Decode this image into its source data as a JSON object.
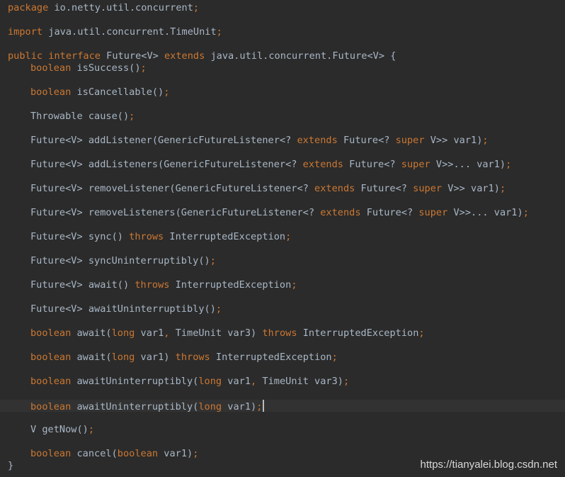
{
  "editor": {
    "theme_colors": {
      "background": "#2b2b2b",
      "keyword": "#cc7832",
      "text": "#a9b7c6",
      "current_line": "#323232"
    },
    "lines": [
      [
        {
          "t": "package",
          "k": "kw"
        },
        {
          "t": " io.netty.util.concurrent",
          "k": "txt"
        },
        {
          "t": ";",
          "k": "sym"
        }
      ],
      [],
      [
        {
          "t": "import",
          "k": "kw"
        },
        {
          "t": " java.util.concurrent.TimeUnit",
          "k": "txt"
        },
        {
          "t": ";",
          "k": "sym"
        }
      ],
      [],
      [
        {
          "t": "public",
          "k": "kw"
        },
        {
          "t": " ",
          "k": "txt"
        },
        {
          "t": "interface",
          "k": "kw"
        },
        {
          "t": " Future<V> ",
          "k": "txt"
        },
        {
          "t": "extends",
          "k": "kw"
        },
        {
          "t": " java.util.concurrent.Future<V> {",
          "k": "txt"
        }
      ],
      [
        {
          "t": "boolean",
          "k": "kw"
        },
        {
          "t": " isSuccess()",
          "k": "txt"
        },
        {
          "t": ";",
          "k": "sym"
        }
      ],
      [],
      [
        {
          "t": "boolean",
          "k": "kw"
        },
        {
          "t": " isCancellable()",
          "k": "txt"
        },
        {
          "t": ";",
          "k": "sym"
        }
      ],
      [],
      [
        {
          "t": "Throwable cause()",
          "k": "txt"
        },
        {
          "t": ";",
          "k": "sym"
        }
      ],
      [],
      [
        {
          "t": "Future<V> addListener(GenericFutureListener<? ",
          "k": "txt"
        },
        {
          "t": "extends",
          "k": "kw"
        },
        {
          "t": " Future<? ",
          "k": "txt"
        },
        {
          "t": "super",
          "k": "kw"
        },
        {
          "t": " V>> var1)",
          "k": "txt"
        },
        {
          "t": ";",
          "k": "sym"
        }
      ],
      [],
      [
        {
          "t": "Future<V> addListeners(GenericFutureListener<? ",
          "k": "txt"
        },
        {
          "t": "extends",
          "k": "kw"
        },
        {
          "t": " Future<? ",
          "k": "txt"
        },
        {
          "t": "super",
          "k": "kw"
        },
        {
          "t": " V>>... var1)",
          "k": "txt"
        },
        {
          "t": ";",
          "k": "sym"
        }
      ],
      [],
      [
        {
          "t": "Future<V> removeListener(GenericFutureListener<? ",
          "k": "txt"
        },
        {
          "t": "extends",
          "k": "kw"
        },
        {
          "t": " Future<? ",
          "k": "txt"
        },
        {
          "t": "super",
          "k": "kw"
        },
        {
          "t": " V>> var1)",
          "k": "txt"
        },
        {
          "t": ";",
          "k": "sym"
        }
      ],
      [],
      [
        {
          "t": "Future<V> removeListeners(GenericFutureListener<? ",
          "k": "txt"
        },
        {
          "t": "extends",
          "k": "kw"
        },
        {
          "t": " Future<? ",
          "k": "txt"
        },
        {
          "t": "super",
          "k": "kw"
        },
        {
          "t": " V>>... var1)",
          "k": "txt"
        },
        {
          "t": ";",
          "k": "sym"
        }
      ],
      [],
      [
        {
          "t": "Future<V> sync() ",
          "k": "txt"
        },
        {
          "t": "throws",
          "k": "kw"
        },
        {
          "t": " InterruptedException",
          "k": "txt"
        },
        {
          "t": ";",
          "k": "sym"
        }
      ],
      [],
      [
        {
          "t": "Future<V> syncUninterruptibly()",
          "k": "txt"
        },
        {
          "t": ";",
          "k": "sym"
        }
      ],
      [],
      [
        {
          "t": "Future<V> await() ",
          "k": "txt"
        },
        {
          "t": "throws",
          "k": "kw"
        },
        {
          "t": " InterruptedException",
          "k": "txt"
        },
        {
          "t": ";",
          "k": "sym"
        }
      ],
      [],
      [
        {
          "t": "Future<V> awaitUninterruptibly()",
          "k": "txt"
        },
        {
          "t": ";",
          "k": "sym"
        }
      ],
      [],
      [
        {
          "t": "boolean",
          "k": "kw"
        },
        {
          "t": " await(",
          "k": "txt"
        },
        {
          "t": "long",
          "k": "kw"
        },
        {
          "t": " var1",
          "k": "txt"
        },
        {
          "t": ",",
          "k": "sym"
        },
        {
          "t": " TimeUnit var3) ",
          "k": "txt"
        },
        {
          "t": "throws",
          "k": "kw"
        },
        {
          "t": " InterruptedException",
          "k": "txt"
        },
        {
          "t": ";",
          "k": "sym"
        }
      ],
      [],
      [
        {
          "t": "boolean",
          "k": "kw"
        },
        {
          "t": " await(",
          "k": "txt"
        },
        {
          "t": "long",
          "k": "kw"
        },
        {
          "t": " var1) ",
          "k": "txt"
        },
        {
          "t": "throws",
          "k": "kw"
        },
        {
          "t": " InterruptedException",
          "k": "txt"
        },
        {
          "t": ";",
          "k": "sym"
        }
      ],
      [],
      [
        {
          "t": "boolean",
          "k": "kw"
        },
        {
          "t": " awaitUninterruptibly(",
          "k": "txt"
        },
        {
          "t": "long",
          "k": "kw"
        },
        {
          "t": " var1",
          "k": "txt"
        },
        {
          "t": ",",
          "k": "sym"
        },
        {
          "t": " TimeUnit var3)",
          "k": "txt"
        },
        {
          "t": ";",
          "k": "sym"
        }
      ],
      [],
      [
        {
          "t": "boolean",
          "k": "kw"
        },
        {
          "t": " awaitUninterruptibly(",
          "k": "txt"
        },
        {
          "t": "long",
          "k": "kw"
        },
        {
          "t": " var1)",
          "k": "txt"
        },
        {
          "t": ";",
          "k": "sym"
        }
      ],
      [],
      [
        {
          "t": "V getNow()",
          "k": "txt"
        },
        {
          "t": ";",
          "k": "sym"
        }
      ],
      [],
      [
        {
          "t": "boolean",
          "k": "kw"
        },
        {
          "t": " cancel(",
          "k": "txt"
        },
        {
          "t": "boolean",
          "k": "kw"
        },
        {
          "t": " var1)",
          "k": "txt"
        },
        {
          "t": ";",
          "k": "sym"
        }
      ],
      [
        {
          "t": "}",
          "k": "txt"
        }
      ]
    ]
  },
  "watermark": {
    "text": "https://tianyalei.blog.csdn.net"
  }
}
